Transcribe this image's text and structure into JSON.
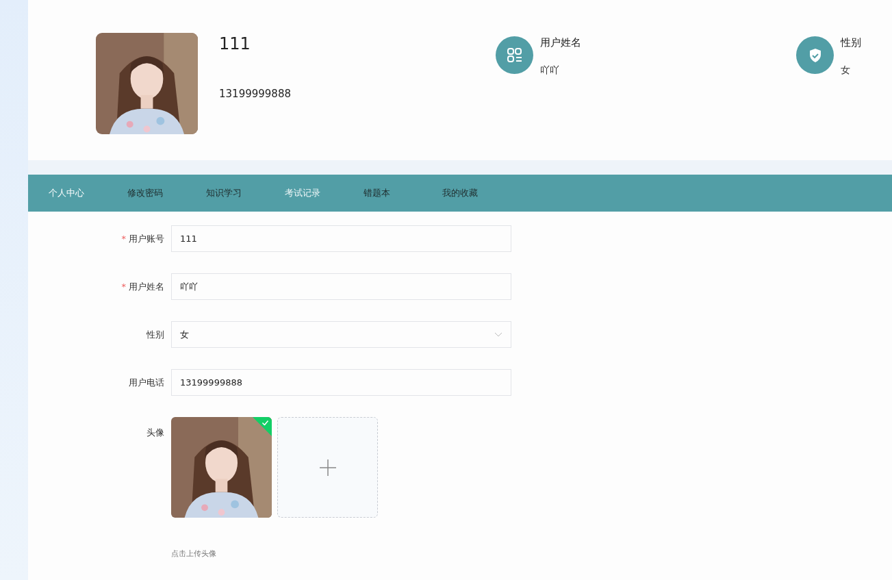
{
  "profile": {
    "name": "111",
    "phone": "13199999888",
    "info": [
      {
        "kind": "name",
        "label": "用户姓名",
        "value": "吖吖"
      },
      {
        "kind": "gender",
        "label": "性别",
        "value": "女"
      }
    ]
  },
  "tabs": [
    {
      "label": "个人中心",
      "selected": true,
      "hovered": false
    },
    {
      "label": "修改密码",
      "selected": false,
      "hovered": false
    },
    {
      "label": "知识学习",
      "selected": false,
      "hovered": false
    },
    {
      "label": "考试记录",
      "selected": false,
      "hovered": true
    },
    {
      "label": "错题本",
      "selected": false,
      "hovered": false
    },
    {
      "label": "我的收藏",
      "selected": false,
      "hovered": false
    }
  ],
  "form": {
    "required_mark": "*",
    "fields": [
      {
        "kind": "text",
        "label": "用户账号",
        "required": true,
        "value": "111"
      },
      {
        "kind": "text",
        "label": "用户姓名",
        "required": true,
        "value": "吖吖"
      },
      {
        "kind": "select",
        "label": "性别",
        "required": false,
        "value": "女"
      },
      {
        "kind": "text",
        "label": "用户电话",
        "required": false,
        "value": "13199999888"
      },
      {
        "label": "头像",
        "required": false,
        "uploaded": true,
        "hint": "点击上传头像"
      }
    ]
  }
}
